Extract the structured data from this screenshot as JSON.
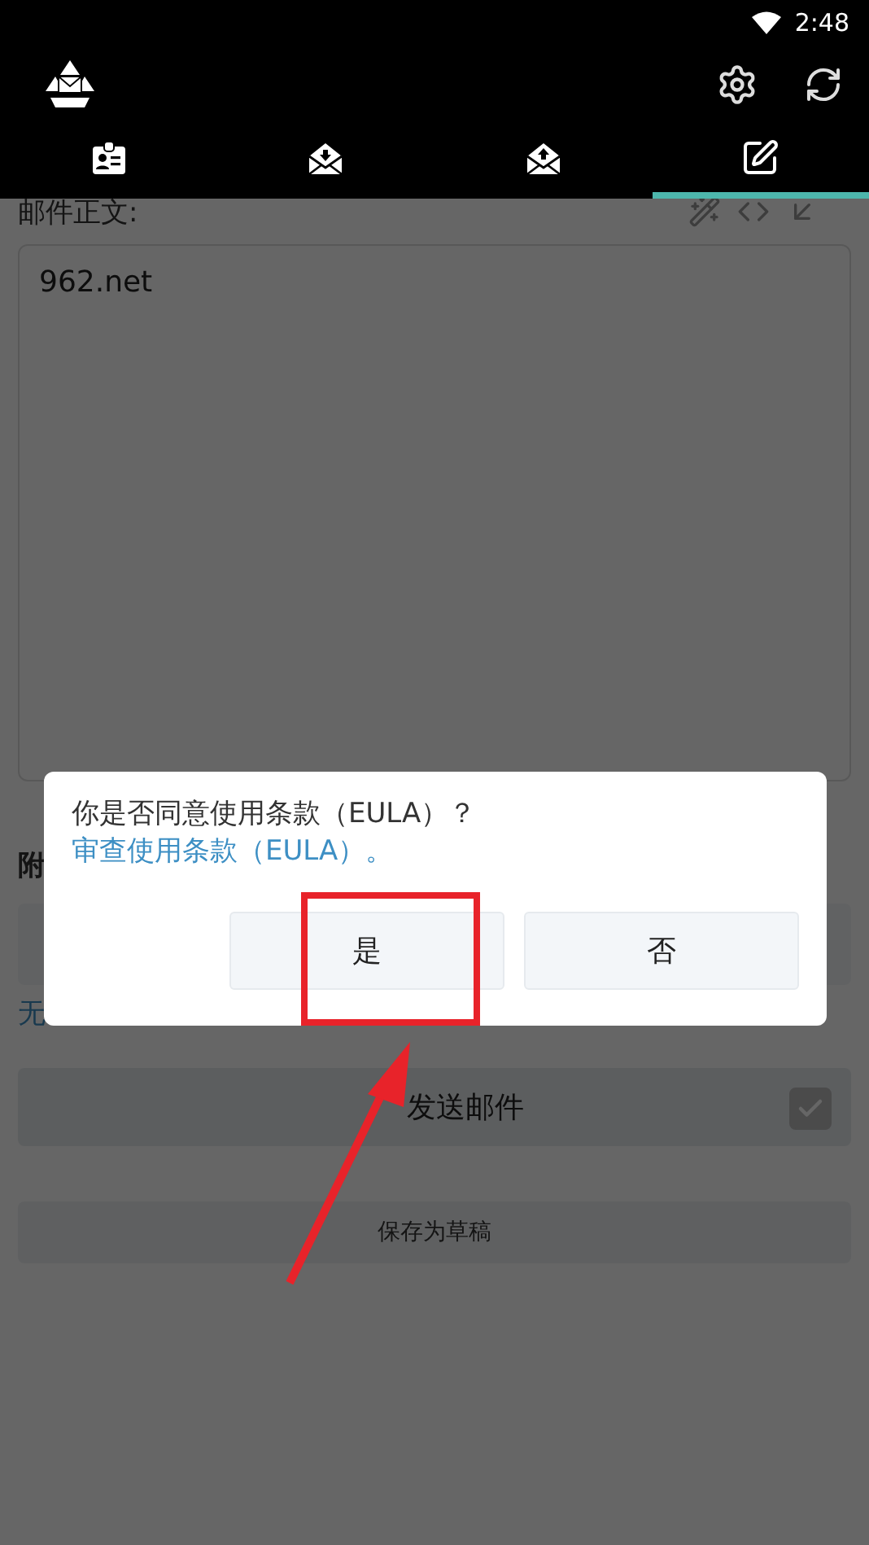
{
  "status_bar": {
    "time": "2:48"
  },
  "tabs": [
    {
      "kind": "contacts",
      "selected": false
    },
    {
      "kind": "inbox",
      "selected": false
    },
    {
      "kind": "outbox",
      "selected": false
    },
    {
      "kind": "compose",
      "selected": true
    }
  ],
  "compose": {
    "body_label": "邮件正文:",
    "body": "962.net",
    "attachments_label": "附",
    "attachments_note": "无",
    "send_button": "发送邮件",
    "send_checked": true,
    "draft_button": "保存为草稿"
  },
  "dialog": {
    "message": "你是否同意使用条款（EULA）？",
    "link": "审查使用条款（EULA）。",
    "buttons": [
      {
        "label": "是",
        "highlighted": true
      },
      {
        "label": "否",
        "highlighted": false
      }
    ]
  }
}
